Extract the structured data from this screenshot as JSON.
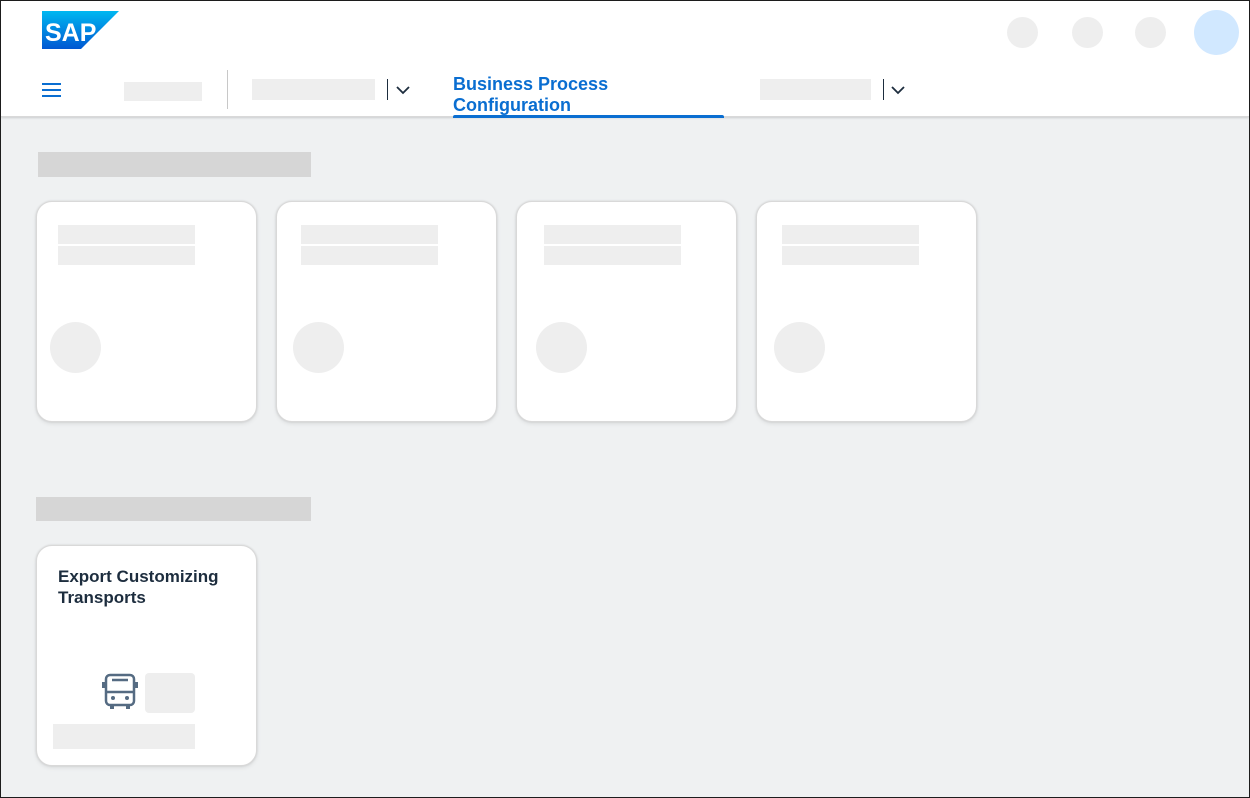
{
  "brand": {
    "logo_text": "SAP",
    "accent": "#0a6ed1",
    "logo_color": "#0a6ed1"
  },
  "header": {
    "menu_icon": "hamburger-menu-icon",
    "active_tab_label": "Business Process Configuration"
  },
  "tiles": {
    "export": {
      "title_line1": "Export Customizing",
      "title_line2": "Transports",
      "icon": "bus-icon"
    }
  }
}
